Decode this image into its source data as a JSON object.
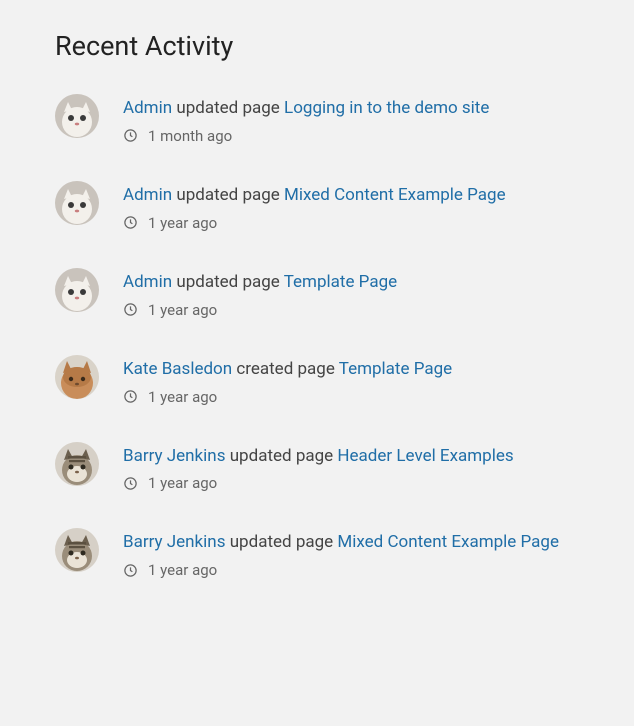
{
  "heading": "Recent Activity",
  "activity": [
    {
      "user": "Admin",
      "avatar": "white-cat",
      "action": "updated page",
      "page": "Logging in to the demo site",
      "time": "1 month ago"
    },
    {
      "user": "Admin",
      "avatar": "white-cat",
      "action": "updated page",
      "page": "Mixed Content Example Page",
      "time": "1 year ago"
    },
    {
      "user": "Admin",
      "avatar": "white-cat",
      "action": "updated page",
      "page": "Template Page",
      "time": "1 year ago"
    },
    {
      "user": "Kate Basledon",
      "avatar": "orange-cat",
      "action": "created page",
      "page": "Template Page",
      "time": "1 year ago"
    },
    {
      "user": "Barry Jenkins",
      "avatar": "tabby-cat",
      "action": "updated page",
      "page": "Header Level Examples",
      "time": "1 year ago"
    },
    {
      "user": "Barry Jenkins",
      "avatar": "tabby-cat",
      "action": "updated page",
      "page": "Mixed Content Example Page",
      "time": "1 year ago"
    }
  ]
}
